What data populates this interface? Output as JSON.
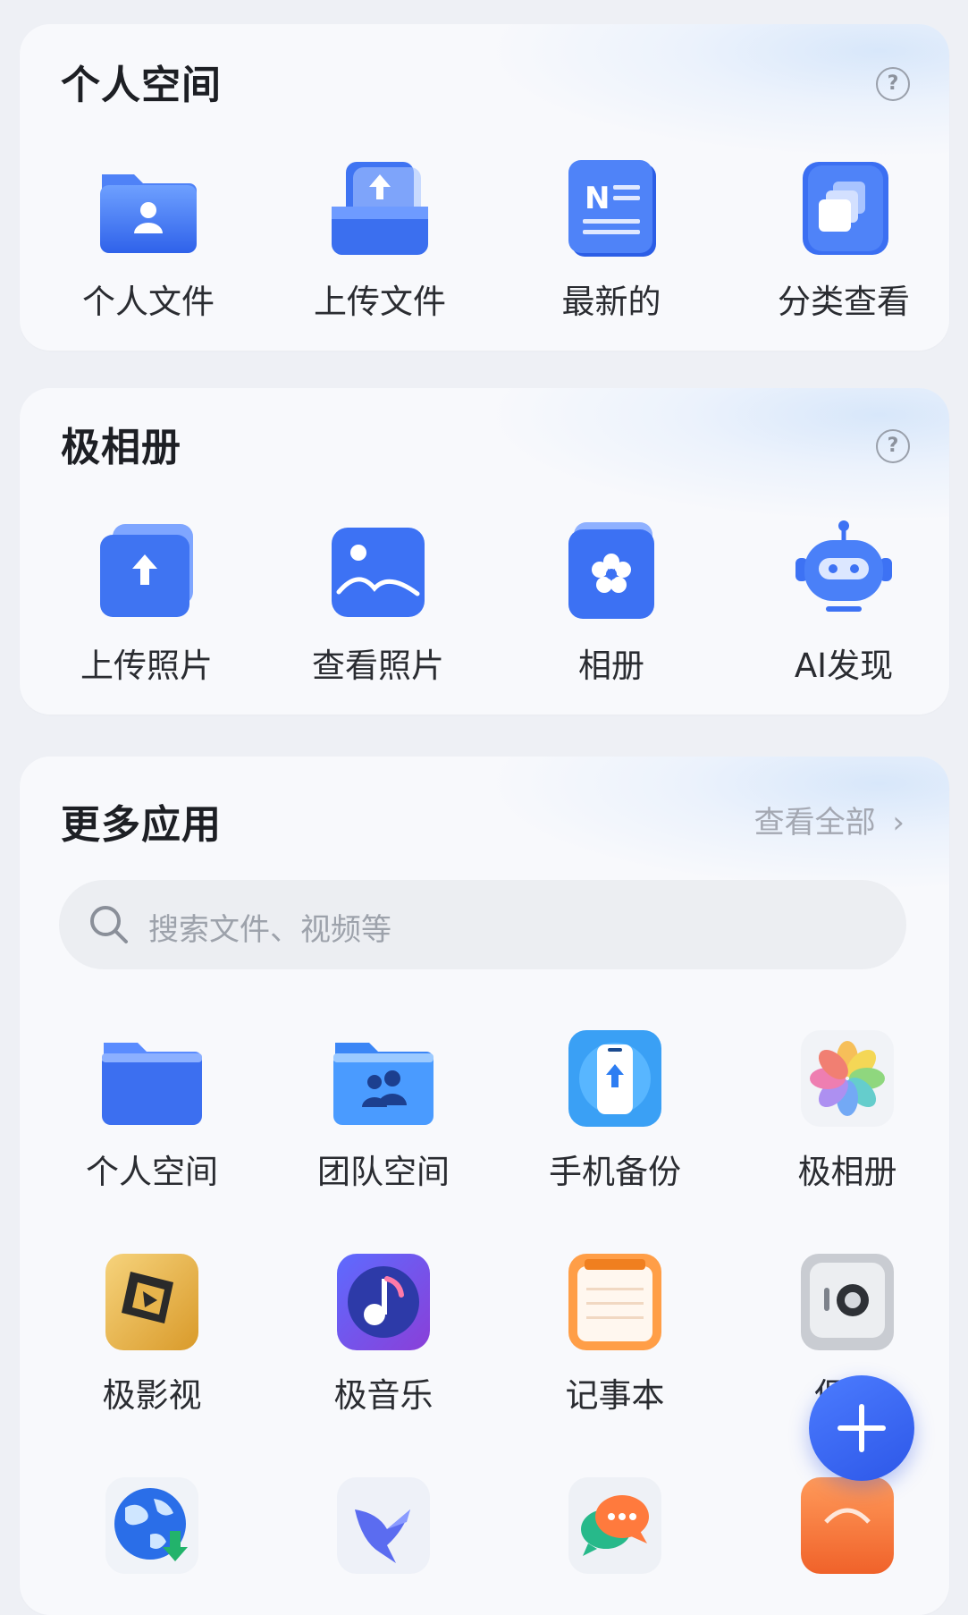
{
  "personal": {
    "title": "个人空间",
    "help": "?",
    "items": [
      {
        "label": "个人文件",
        "icon": "person-folder-icon"
      },
      {
        "label": "上传文件",
        "icon": "upload-tray-icon"
      },
      {
        "label": "最新的",
        "icon": "notebook-n-icon"
      },
      {
        "label": "分类查看",
        "icon": "layers-icon"
      }
    ]
  },
  "album": {
    "title": "极相册",
    "help": "?",
    "items": [
      {
        "label": "上传照片",
        "icon": "upload-photo-icon"
      },
      {
        "label": "查看照片",
        "icon": "image-icon"
      },
      {
        "label": "相册",
        "icon": "flower-album-icon"
      },
      {
        "label": "AI发现",
        "icon": "robot-icon"
      }
    ]
  },
  "more": {
    "title": "更多应用",
    "view_all": "查看全部",
    "search_placeholder": "搜索文件、视频等",
    "apps": [
      {
        "label": "个人空间",
        "icon": "blue-folder-icon"
      },
      {
        "label": "团队空间",
        "icon": "team-folder-icon"
      },
      {
        "label": "手机备份",
        "icon": "phone-backup-icon"
      },
      {
        "label": "极相册",
        "icon": "photos-flower-icon"
      },
      {
        "label": "极影视",
        "icon": "film-icon"
      },
      {
        "label": "极音乐",
        "icon": "music-note-icon"
      },
      {
        "label": "记事本",
        "icon": "notepad-icon"
      },
      {
        "label": "保险",
        "icon": "safe-icon"
      },
      {
        "label": "",
        "icon": "globe-download-icon"
      },
      {
        "label": "",
        "icon": "bird-icon"
      },
      {
        "label": "",
        "icon": "chat-bubbles-icon"
      },
      {
        "label": "",
        "icon": "orange-app-icon"
      }
    ]
  },
  "fab": {
    "icon": "plus-icon"
  },
  "colors": {
    "accent": "#3d6cf2",
    "background": "#eef0f5",
    "card": "#f8f9fc"
  }
}
